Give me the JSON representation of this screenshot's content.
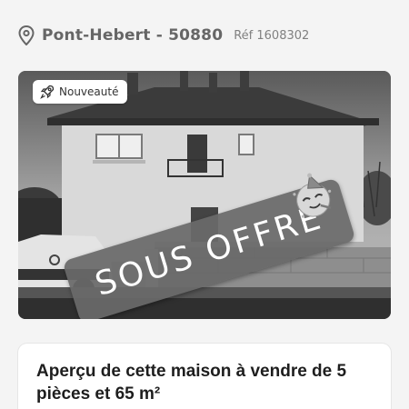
{
  "location": {
    "icon": "location-pin-icon",
    "title": "Pont-Hebert - 50880",
    "reference": "Réf 1608302"
  },
  "listing": {
    "badge_label": "Nouveauté",
    "badge_icon": "rocket-icon",
    "overlay_label": "SOUS OFFRE",
    "overlay_icon": "party-face-icon",
    "photo_alt": "house-photo"
  },
  "description": {
    "title": "Aperçu de cette maison à vendre de 5 pièces et 65 m²"
  }
}
